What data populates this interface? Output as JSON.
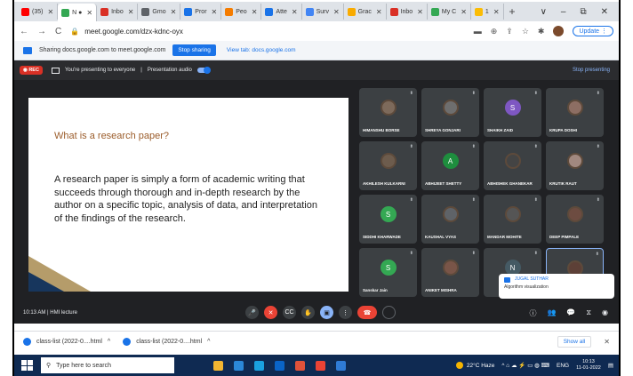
{
  "browser": {
    "tabs": [
      {
        "label": "(35)",
        "color": "#ff0000"
      },
      {
        "label": "N ●",
        "color": "#34a853",
        "active": true
      },
      {
        "label": "Inbo",
        "color": "#d93025"
      },
      {
        "label": "Gmo",
        "color": "#5f6368"
      },
      {
        "label": "Pror",
        "color": "#1a73e8"
      },
      {
        "label": "Peo",
        "color": "#f57c00"
      },
      {
        "label": "Atte",
        "color": "#1a73e8"
      },
      {
        "label": "Surv",
        "color": "#4285f4"
      },
      {
        "label": "Grac",
        "color": "#f9ab00"
      },
      {
        "label": "Inbo",
        "color": "#d93025"
      },
      {
        "label": "My C",
        "color": "#34a853"
      },
      {
        "label": "1",
        "color": "#fbbc04"
      }
    ],
    "new_tab": "+",
    "window_controls": [
      "∨",
      "–",
      "⧉",
      "✕"
    ],
    "url": "meet.google.com/dzx-kdnc-oyx",
    "update_label": "Update"
  },
  "share_bar": {
    "text": "Sharing docs.google.com to meet.google.com",
    "stop_label": "Stop sharing",
    "view_label": "View tab: docs.google.com"
  },
  "meet": {
    "rec": "REC",
    "presenting_text": "You're presenting to everyone",
    "presentation_audio": "Presentation audio",
    "stop_presenting": "Stop presenting",
    "time_meeting": "10:13 AM  |  HMI lecture",
    "slide": {
      "title": "What is a research paper?",
      "body": "A research paper is simply a form of academic writing that succeeds through thorough and in-depth research by the author on a specific topic, analysis of data, and interpretation of the findings of the research."
    },
    "participants": [
      {
        "name": "HIMANSHU BORSE",
        "initial": "",
        "color": "#7d6a5b"
      },
      {
        "name": "SHREYA GONJARI",
        "initial": "",
        "color": "#6e6e6e"
      },
      {
        "name": "SHAIKH ZAID",
        "initial": "S",
        "color": "#7e57c2"
      },
      {
        "name": "KRUPA DOSHI",
        "initial": "",
        "color": "#8d6e63"
      },
      {
        "name": "AKHILESH KULKARNI",
        "initial": "",
        "color": "#6d5c4d"
      },
      {
        "name": "ABHIJEET SHETTY",
        "initial": "A",
        "color": "#1e8e3e"
      },
      {
        "name": "ABHISHEK GHANEKAR",
        "initial": "",
        "color": "#444"
      },
      {
        "name": "KRUTIK RAUT",
        "initial": "",
        "color": "#a1887f"
      },
      {
        "name": "SIDDHI KHARWADE",
        "initial": "S",
        "color": "#34a853"
      },
      {
        "name": "KAUSHAL VYAS",
        "initial": "",
        "color": "#5f6368"
      },
      {
        "name": "MANDAR MOHITE",
        "initial": "",
        "color": "#555"
      },
      {
        "name": "DEEP PIMPALE",
        "initial": "",
        "color": "#6d4c41"
      },
      {
        "name": "Sanskar Jain",
        "initial": "S",
        "color": "#34a853"
      },
      {
        "name": "ANIKET MISHRA",
        "initial": "",
        "color": "#795548"
      },
      {
        "name": "",
        "initial": "N",
        "color": "#455a64"
      },
      {
        "name": "",
        "initial": "",
        "color": "#5d4037"
      }
    ],
    "chat_popup": {
      "name": "JUGAL SUTHAR",
      "message": "Algorithm visualization"
    },
    "controls": [
      "mic",
      "cam-off",
      "captions",
      "raise-hand",
      "present",
      "more",
      "end-call",
      "ring"
    ]
  },
  "downloads": {
    "items": [
      "class-list (2022-0....html",
      "class-list (2022-0....html"
    ],
    "show_all": "Show all"
  },
  "taskbar": {
    "search_placeholder": "Type here to search",
    "weather": "22°C  Haze",
    "lang": "ENG",
    "time": "10:13",
    "date": "11-01-2022"
  }
}
